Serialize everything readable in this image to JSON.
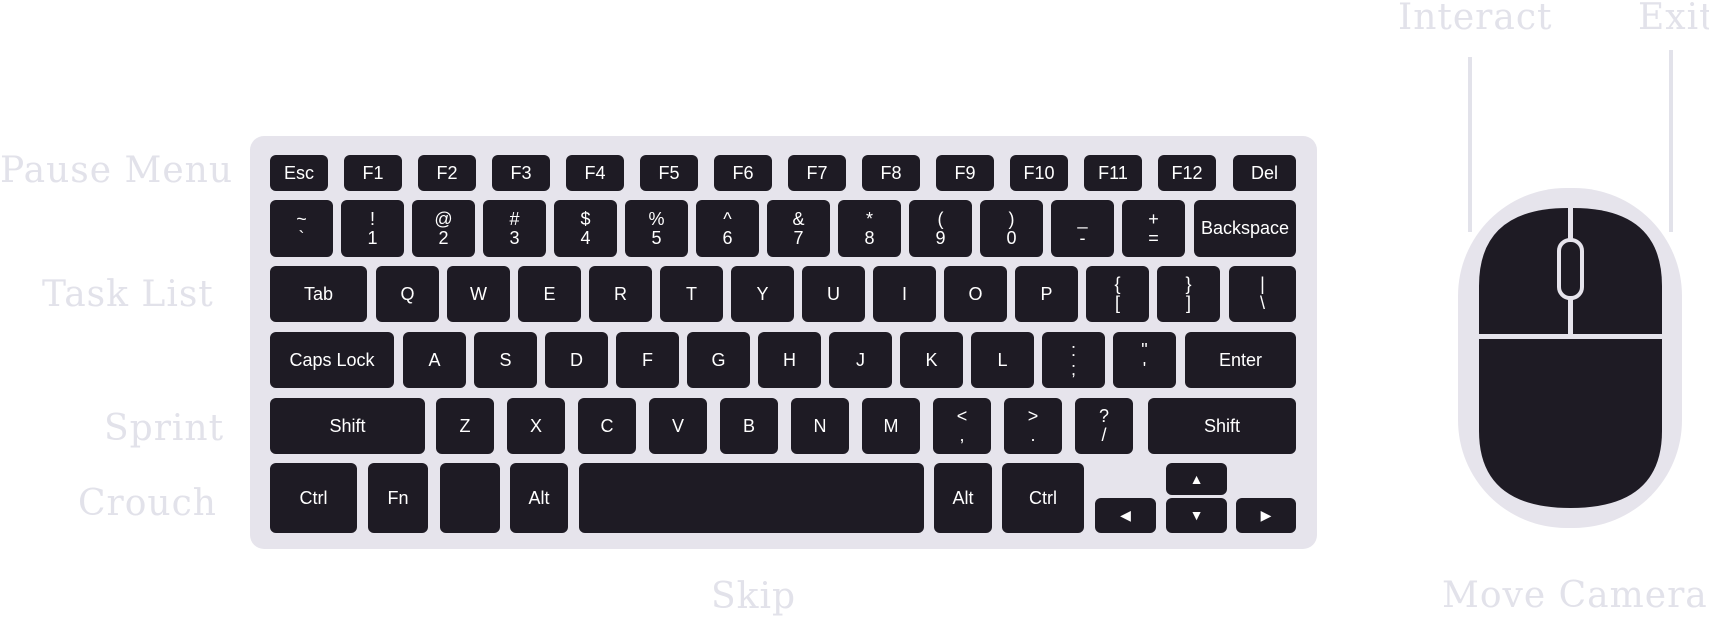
{
  "labels": {
    "pause_menu": "Pause Menu",
    "task_list": "Task List",
    "sprint": "Sprint",
    "crouch": "Crouch",
    "skip": "Skip",
    "interact": "Interact",
    "exit": "Exit",
    "move_camera": "Move Camera"
  },
  "keys": {
    "esc": "Esc",
    "f1": "F1",
    "f2": "F2",
    "f3": "F3",
    "f4": "F4",
    "f5": "F5",
    "f6": "F6",
    "f7": "F7",
    "f8": "F8",
    "f9": "F9",
    "f10": "F10",
    "f11": "F11",
    "f12": "F12",
    "del": "Del",
    "tilde_top": "~",
    "tilde_bot": "`",
    "n1_top": "!",
    "n1_bot": "1",
    "n2_top": "@",
    "n2_bot": "2",
    "n3_top": "#",
    "n3_bot": "3",
    "n4_top": "$",
    "n4_bot": "4",
    "n5_top": "%",
    "n5_bot": "5",
    "n6_top": "^",
    "n6_bot": "6",
    "n7_top": "&",
    "n7_bot": "7",
    "n8_top": "*",
    "n8_bot": "8",
    "n9_top": "(",
    "n9_bot": "9",
    "n0_top": ")",
    "n0_bot": "0",
    "minus_top": "_",
    "minus_bot": "-",
    "equals_top": "+",
    "equals_bot": "=",
    "backspace": "Backspace",
    "tab": "Tab",
    "q": "Q",
    "w": "W",
    "e": "E",
    "r": "R",
    "t": "T",
    "y": "Y",
    "u": "U",
    "i": "I",
    "o": "O",
    "p": "P",
    "lbracket_top": "{",
    "lbracket_bot": "[",
    "rbracket_top": "}",
    "rbracket_bot": "]",
    "backslash_top": "|",
    "backslash_bot": "\\",
    "caps": "Caps Lock",
    "a": "A",
    "s": "S",
    "d": "D",
    "f": "F",
    "g": "G",
    "h": "H",
    "j": "J",
    "k": "K",
    "l": "L",
    "semicolon_top": ":",
    "semicolon_bot": ";",
    "quote_top": "\"",
    "quote_bot": "'",
    "enter": "Enter",
    "lshift": "Shift",
    "z": "Z",
    "x": "X",
    "c": "C",
    "v": "V",
    "b": "B",
    "n": "N",
    "m": "M",
    "comma_top": "<",
    "comma_bot": ",",
    "period_top": ">",
    "period_bot": ".",
    "slash_top": "?",
    "slash_bot": "/",
    "rshift": "Shift",
    "lctrl": "Ctrl",
    "fn": "Fn",
    "lalt": "Alt",
    "ralt": "Alt",
    "rctrl": "Ctrl",
    "up": "▲",
    "down": "▼",
    "left": "◀",
    "right": "▶"
  }
}
